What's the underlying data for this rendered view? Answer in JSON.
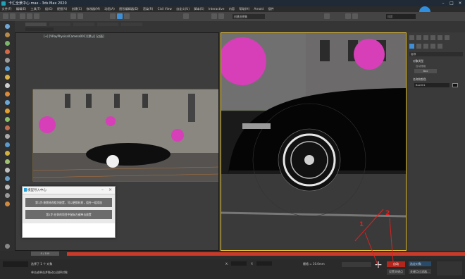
{
  "titlebar": {
    "title": "卡汇全景中心.max - 3ds Max 2020"
  },
  "menubar": [
    "文件(F)",
    "编辑(E)",
    "工具(T)",
    "组(G)",
    "视图(V)",
    "创建(C)",
    "修改器(M)",
    "动画(A)",
    "图形编辑器(D)",
    "渲染(R)",
    "Civil View",
    "自定义(U)",
    "脚本(S)",
    "Interactive",
    "内容",
    "帮助(H)",
    "Arnold",
    "插件"
  ],
  "toolbar": {
    "selection_set": "创建选择集",
    "search_placeholder": "搜索"
  },
  "viewport_left": {
    "label": "[+] [VRayPhysicalCamera001] [默认] [边面]"
  },
  "dialog": {
    "title": "模型导入中心",
    "option1": "第1步:按需修改相关配置，可以更换材质，组合一组添加",
    "option2": "第2步:在你的项目中鼠标左键单击放置"
  },
  "command_panel": {
    "header": "名称",
    "section1": "对象类型",
    "autogrid": "自动栅格",
    "item1": "Box",
    "section2": "名称和颜色",
    "name_field": "Box001"
  },
  "timeline": {
    "frame": "0 / 100"
  },
  "status": {
    "selected": "选择了 1 个 对象",
    "hint": "单击或单击并拖动以选择对象",
    "auto_key": "自动",
    "set_key": "设置关键点",
    "key_filter": "关键点过滤器...",
    "selected_dropdown": "选定对象",
    "x_coord": "X:",
    "y_coord": "Y:",
    "grid": "栅格 = 10.0mm"
  },
  "annotations": {
    "a1": "1",
    "a2": "2"
  },
  "colors": {
    "accent": "#3f8fd6",
    "viewport_border": "#e8c43a",
    "timeline": "#c93a2a",
    "annotation": "#e02020"
  }
}
